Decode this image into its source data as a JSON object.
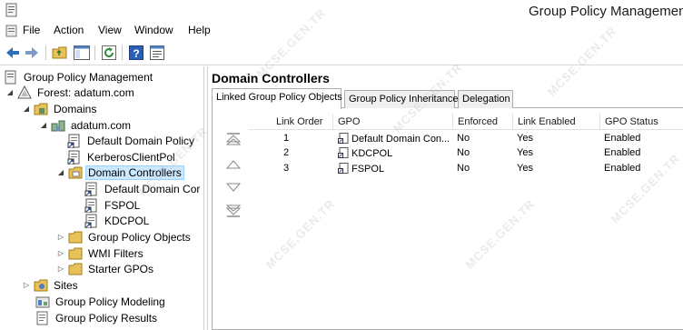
{
  "window": {
    "title": "Group Policy Management"
  },
  "menu": [
    "File",
    "Action",
    "View",
    "Window",
    "Help"
  ],
  "toolbar": [
    "back-icon",
    "forward-icon",
    "folder-up-icon",
    "show-hide-tree-icon",
    "refresh-icon",
    "help-icon",
    "properties-icon"
  ],
  "tree": {
    "root": "Group Policy Management",
    "forest": "Forest: adatum.com",
    "domains": "Domains",
    "domain": "adatum.com",
    "gpo_links": [
      "Default Domain Policy",
      "KerberosClientPol"
    ],
    "selected_ou": "Domain Controllers",
    "ou_links": [
      "Default Domain Cor",
      "FSPOL",
      "KDCPOL"
    ],
    "folders": [
      "Group Policy Objects",
      "WMI Filters",
      "Starter GPOs"
    ],
    "sites": "Sites",
    "modeling": "Group Policy Modeling",
    "results": "Group Policy Results"
  },
  "main": {
    "title": "Domain Controllers",
    "tabs": [
      {
        "label": "Linked Group Policy Objects",
        "active": true
      },
      {
        "label": "Group Policy Inheritance",
        "active": false
      },
      {
        "label": "Delegation",
        "active": false
      }
    ],
    "columns": [
      "Link Order",
      "GPO",
      "Enforced",
      "Link Enabled",
      "GPO Status"
    ],
    "rows": [
      {
        "order": "1",
        "gpo": "Default Domain Con...",
        "enforced": "No",
        "link_enabled": "Yes",
        "status": "Enabled"
      },
      {
        "order": "2",
        "gpo": "KDCPOL",
        "enforced": "No",
        "link_enabled": "Yes",
        "status": "Enabled"
      },
      {
        "order": "3",
        "gpo": "FSPOL",
        "enforced": "No",
        "link_enabled": "Yes",
        "status": "Enabled"
      }
    ]
  },
  "watermark": "MCSE.GEN.TR",
  "colors": {
    "selection": "#cce8ff",
    "folder": "#e8c15a",
    "help": "#2b5fb4"
  }
}
